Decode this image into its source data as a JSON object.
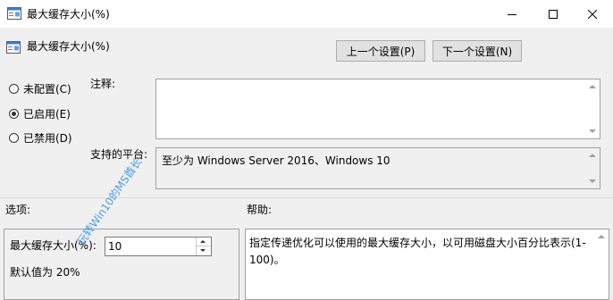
{
  "window": {
    "title": "最大缓存大小(%)",
    "controls": {
      "minimize_icon": "minimize-icon",
      "maximize_icon": "maximize-icon",
      "close_icon": "close-icon"
    }
  },
  "header": {
    "policy_name": "最大缓存大小(%)",
    "prev_button": "上一个设置(P)",
    "next_button": "下一个设置(N)"
  },
  "state": {
    "options": [
      {
        "label": "未配置(C)",
        "selected": false
      },
      {
        "label": "已启用(E)",
        "selected": true
      },
      {
        "label": "已禁用(D)",
        "selected": false
      }
    ]
  },
  "comment": {
    "label": "注释:",
    "value": ""
  },
  "platform": {
    "label": "支持的平台:",
    "value": "至少为 Windows Server 2016、Windows 10"
  },
  "options_section": {
    "label": "选项:",
    "field_label": "最大缓存大小(%):",
    "field_value": "10",
    "default_text": "默认值为 20%"
  },
  "help_section": {
    "label": "帮助:",
    "text": "指定传递优化可以使用的最大缓存大小，以可用磁盘大小百分比表示(1-100)。"
  },
  "watermark": "玩转Win10的MS酋长",
  "colors": {
    "background": "#f0f0f0",
    "watermark": "#2f8de4",
    "button_face": "#e1e1e1"
  }
}
